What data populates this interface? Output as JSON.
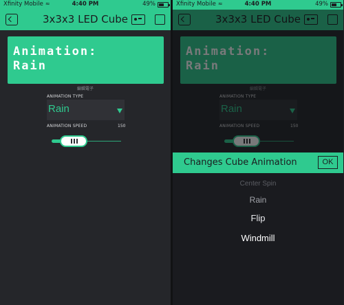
{
  "status": {
    "carrier": "Xfinity Mobile",
    "time": "4:40 PM",
    "battery": "49%",
    "battery_level": 0.49
  },
  "app": {
    "title": "3x3x3 LED Cube"
  },
  "lcd": {
    "line1": "Animation:",
    "line2": "Rain",
    "caption": "編輯電子"
  },
  "controls": {
    "animation_type_label": "ANIMATION TYPE",
    "animation_type_value": "Rain",
    "animation_speed_label": "ANIMATION SPEED",
    "animation_speed_value": "150"
  },
  "popup": {
    "title": "Changes Cube Animation",
    "ok_label": "OK",
    "options": [
      "Center Spin",
      "Rain",
      "Flip",
      "Windmill"
    ]
  },
  "colors": {
    "accent": "#2fca8f",
    "background": "#25262a"
  },
  "icons": [
    "back-icon",
    "wifi-icon",
    "battery-icon",
    "device-icon",
    "square-icon",
    "dropdown-arrow-icon",
    "slider-grip-icon"
  ]
}
